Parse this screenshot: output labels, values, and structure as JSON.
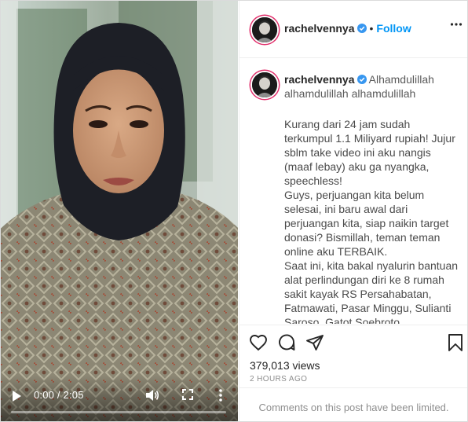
{
  "post": {
    "username": "rachelvennya",
    "follow_label": "Follow",
    "separator": "•",
    "views": "379,013 views",
    "time_ago": "2 HOURS AGO",
    "comments_notice": "Comments on this post have been limited."
  },
  "caption": {
    "first_line": "Alhamdulillah alhamdulillah alhamdulillah",
    "body": "Kurang dari 24 jam sudah terkumpul 1.1 Miliyard rupiah! Jujur sblm take video ini aku nangis (maaf lebay) aku ga nyangka, speechless!\nGuys, perjuangan kita belum selesai, ini baru awal dari perjuangan kita, siap naikin target donasi? Bismillah, teman teman online aku TERBAIK.\nSaat ini, kita bakal nyalurin bantuan alat perlindungan diri ke 8 rumah sakit kayak RS Persahabatan, Fatmawati, Pasar Minggu, Sulianti Saroso, Gatot Soebroto, Mintoharjo, Bhayangkara, dan RSUD Cengkareng, dan akan lebih banyak lagi seiring berjalannya donasi dari orang2 baik."
  },
  "video": {
    "time_display": "0:00 / 2:05",
    "progress": 0
  },
  "icons": {
    "verified": "verified-badge-icon",
    "more": "more-options-icon",
    "like": "heart-icon",
    "comment": "comment-icon",
    "share": "share-icon",
    "save": "bookmark-icon",
    "play": "play-icon",
    "volume": "volume-icon",
    "fullscreen": "fullscreen-icon",
    "video_more": "vertical-dots-icon"
  },
  "colors": {
    "follow": "#0095f6",
    "verified": "#3897f0",
    "muted_text": "#8e8e8e"
  }
}
